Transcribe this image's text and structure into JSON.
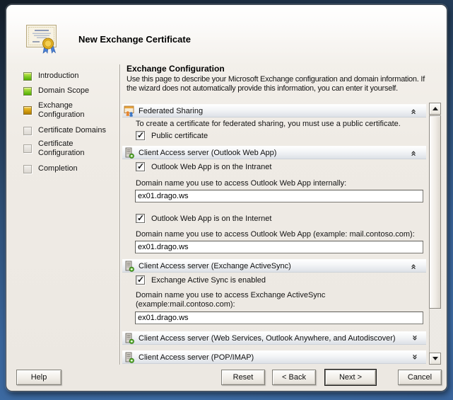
{
  "window": {
    "title": "New Exchange Certificate"
  },
  "colors": {
    "frame_blue": "#3e6da6",
    "frame_dark": "#16202c",
    "dialog_bg": "#efebe5",
    "section_bar_bottom": "#dde1e7",
    "step_done_green": "#5cb400",
    "step_current_amber": "#cf9a00",
    "step_pending_gray": "#dcd8d2"
  },
  "icons": {
    "header": "certificate-icon",
    "federated_sharing": "federated-sharing-icon",
    "client_access_server": "server-icon",
    "expanded_section": "collapse-chevron-icon",
    "collapsed_section": "expand-chevron-icon",
    "scroll_up": "up-arrow-icon",
    "scroll_down": "down-arrow-icon"
  },
  "sidebar": {
    "steps": [
      {
        "label": "Introduction",
        "status": "done"
      },
      {
        "label": "Domain Scope",
        "status": "done"
      },
      {
        "label": "Exchange Configuration",
        "status": "current"
      },
      {
        "label": "Certificate Domains",
        "status": "pending"
      },
      {
        "label": "Certificate Configuration",
        "status": "pending"
      },
      {
        "label": "Completion",
        "status": "pending"
      }
    ]
  },
  "content": {
    "heading": "Exchange Configuration",
    "description": "Use this page to describe your Microsoft Exchange configuration and domain information. If the wizard does not automatically provide this information, you can enter it yourself.",
    "sections": [
      {
        "title": "Federated Sharing",
        "expanded": true,
        "note": "To create a certificate for federated sharing, you must use a public certificate.",
        "checkbox": {
          "label": "Public certificate",
          "checked": true
        }
      },
      {
        "title": "Client Access server (Outlook Web App)",
        "expanded": true,
        "groups": [
          {
            "checkbox": {
              "label": "Outlook Web App is on the Intranet",
              "checked": true
            },
            "field": {
              "label": "Domain name you use to access Outlook Web App internally:",
              "value": "ex01.drago.ws"
            }
          },
          {
            "checkbox": {
              "label": "Outlook Web App is on the Internet",
              "checked": true
            },
            "field": {
              "label": "Domain name you use to access Outlook Web App (example: mail.contoso.com):",
              "value": "ex01.drago.ws"
            }
          }
        ]
      },
      {
        "title": "Client Access server (Exchange ActiveSync)",
        "expanded": true,
        "checkbox": {
          "label": "Exchange Active Sync is enabled",
          "checked": true
        },
        "field": {
          "label": "Domain name you use to access Exchange ActiveSync",
          "label2": "(example:mail.contoso.com):",
          "value": "ex01.drago.ws"
        }
      },
      {
        "title": "Client Access server (Web Services, Outlook Anywhere, and Autodiscover)",
        "expanded": false
      },
      {
        "title": "Client Access server (POP/IMAP)",
        "expanded": false
      }
    ]
  },
  "footer": {
    "help": "Help",
    "reset": "Reset",
    "back": "< Back",
    "next": "Next >",
    "cancel": "Cancel"
  }
}
